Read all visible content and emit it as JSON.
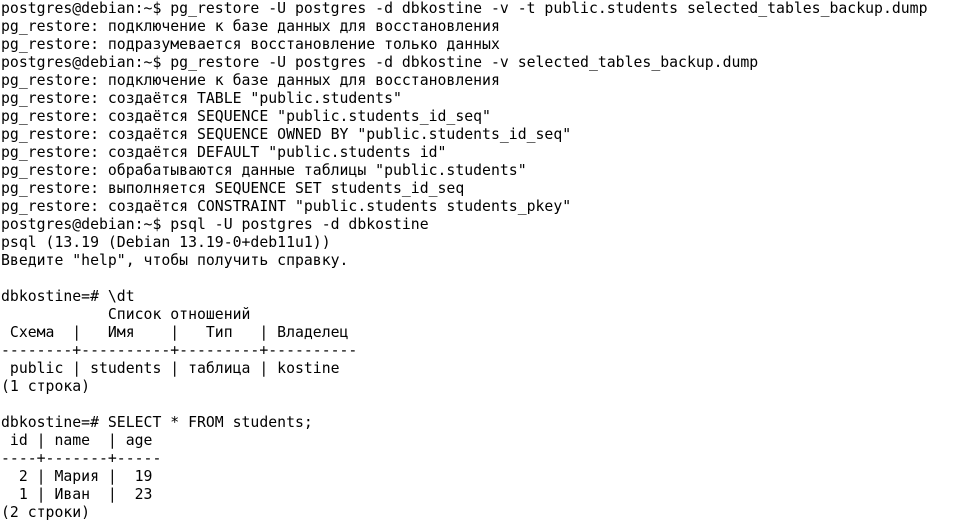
{
  "terminal": {
    "lines": [
      "postgres@debian:~$ pg_restore -U postgres -d dbkostine -v -t public.students selected_tables_backup.dump",
      "pg_restore: подключение к базе данных для восстановления",
      "pg_restore: подразумевается восстановление только данных",
      "postgres@debian:~$ pg_restore -U postgres -d dbkostine -v selected_tables_backup.dump",
      "pg_restore: подключение к базе данных для восстановления",
      "pg_restore: создаётся TABLE \"public.students\"",
      "pg_restore: создаётся SEQUENCE \"public.students_id_seq\"",
      "pg_restore: создаётся SEQUENCE OWNED BY \"public.students_id_seq\"",
      "pg_restore: создаётся DEFAULT \"public.students id\"",
      "pg_restore: обрабатываются данные таблицы \"public.students\"",
      "pg_restore: выполняется SEQUENCE SET students_id_seq",
      "pg_restore: создаётся CONSTRAINT \"public.students students_pkey\"",
      "postgres@debian:~$ psql -U postgres -d dbkostine",
      "psql (13.19 (Debian 13.19-0+deb11u1))",
      "Введите \"help\", чтобы получить справку.",
      "",
      "dbkostine=# \\dt",
      "            Список отношений",
      " Схема  |   Имя    |   Тип   | Владелец",
      "--------+----------+---------+----------",
      " public | students | таблица | kostine",
      "(1 строка)",
      "",
      "dbkostine=# SELECT * FROM students;",
      " id | name  | age",
      "----+-------+-----",
      "  2 | Мария |  19",
      "  1 | Иван  |  23",
      "(2 строки)"
    ]
  }
}
